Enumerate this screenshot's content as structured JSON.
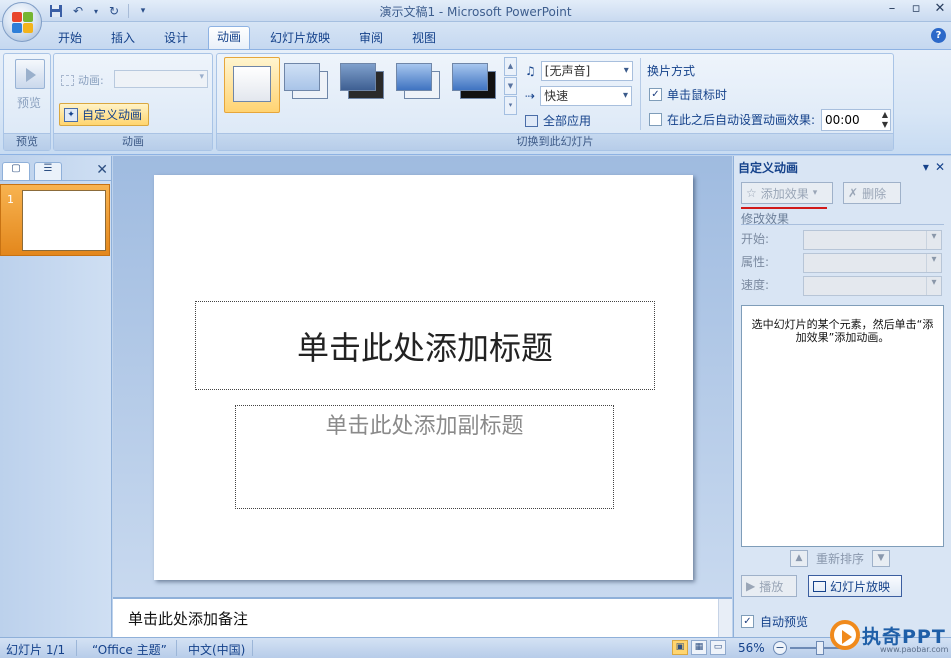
{
  "window": {
    "title": "演示文稿1 - Microsoft PowerPoint"
  },
  "qat": {
    "icons": [
      "save-icon",
      "undo-icon",
      "redo-icon",
      "customize-icon"
    ]
  },
  "tabs": [
    {
      "label": "开始"
    },
    {
      "label": "插入"
    },
    {
      "label": "设计"
    },
    {
      "label": "动画",
      "active": true
    },
    {
      "label": "幻灯片放映"
    },
    {
      "label": "审阅"
    },
    {
      "label": "视图"
    }
  ],
  "ribbon": {
    "preview_group": {
      "label": "预览",
      "button": "预览"
    },
    "animation_group": {
      "label": "动画",
      "anim_label": "动画:",
      "anim_value": "",
      "custom_button": "自定义动画"
    },
    "transition_group": {
      "label": "切换到此幻灯片",
      "sound_value": "[无声音]",
      "speed_value": "快速",
      "apply_all": "全部应用"
    },
    "advance_group": {
      "title": "换片方式",
      "on_click": "单击鼠标时",
      "on_click_checked": true,
      "auto_after": "在此之后自动设置动画效果:",
      "auto_after_checked": false,
      "time": "00:00"
    }
  },
  "slides_pane": {
    "slide_number": "1"
  },
  "slide": {
    "title_placeholder": "单击此处添加标题",
    "subtitle_placeholder": "单击此处添加副标题"
  },
  "notes": {
    "placeholder": "单击此处添加备注"
  },
  "task_pane": {
    "title": "自定义动画",
    "add_effect": "添加效果",
    "delete": "删除",
    "modify_section": "修改效果",
    "start_label": "开始:",
    "property_label": "属性:",
    "speed_label": "速度:",
    "hint": "选中幻灯片的某个元素，然后单击“添加效果”添加动画。",
    "reorder": "重新排序",
    "play": "播放",
    "slideshow": "幻灯片放映",
    "auto_preview": "自动预览",
    "auto_preview_checked": true
  },
  "status": {
    "slide_info": "幻灯片 1/1",
    "theme": "“Office 主题”",
    "language": "中文(中国)",
    "zoom": "56%"
  },
  "watermark": {
    "text": "执奇PPT",
    "url": "www.paobar.com"
  },
  "colors": {
    "accent": "#15428b",
    "selection": "#ffd56f",
    "annotation_red": "#d11a1a"
  }
}
